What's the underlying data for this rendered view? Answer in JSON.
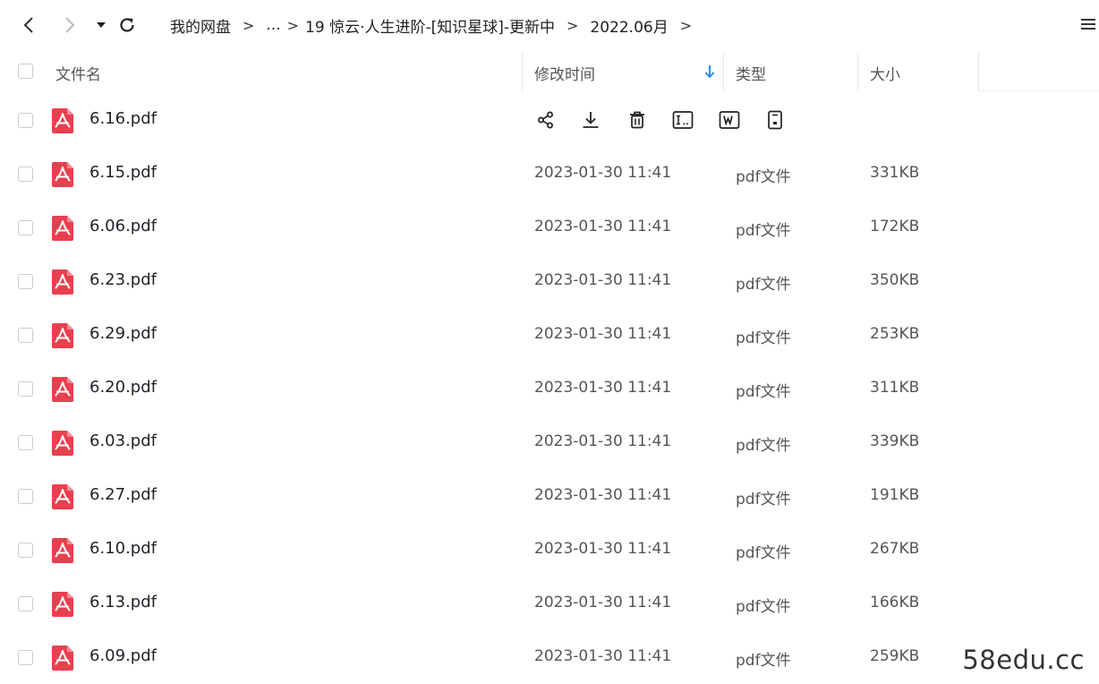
{
  "nav": {
    "back_icon": "chevron-left-icon",
    "forward_icon": "chevron-right-icon",
    "history_icon": "caret-down-icon",
    "refresh_icon": "refresh-icon"
  },
  "breadcrumb": {
    "items": [
      "我的网盘",
      "...",
      "19 惊云·人生进阶-[知识星球]-更新中",
      "2022.06月"
    ],
    "separator": ">"
  },
  "table": {
    "columns": {
      "name": "文件名",
      "modified": "修改时间",
      "type": "类型",
      "size": "大小"
    },
    "sort_icon": "arrow-down-icon",
    "rows": [
      {
        "name": "6.16.pdf",
        "modified": "",
        "type": "",
        "size": "",
        "hovered": true
      },
      {
        "name": "6.15.pdf",
        "modified": "2023-01-30 11:41",
        "type": "pdf文件",
        "size": "331KB"
      },
      {
        "name": "6.06.pdf",
        "modified": "2023-01-30 11:41",
        "type": "pdf文件",
        "size": "172KB"
      },
      {
        "name": "6.23.pdf",
        "modified": "2023-01-30 11:41",
        "type": "pdf文件",
        "size": "350KB"
      },
      {
        "name": "6.29.pdf",
        "modified": "2023-01-30 11:41",
        "type": "pdf文件",
        "size": "253KB"
      },
      {
        "name": "6.20.pdf",
        "modified": "2023-01-30 11:41",
        "type": "pdf文件",
        "size": "311KB"
      },
      {
        "name": "6.03.pdf",
        "modified": "2023-01-30 11:41",
        "type": "pdf文件",
        "size": "339KB"
      },
      {
        "name": "6.27.pdf",
        "modified": "2023-01-30 11:41",
        "type": "pdf文件",
        "size": "191KB"
      },
      {
        "name": "6.10.pdf",
        "modified": "2023-01-30 11:41",
        "type": "pdf文件",
        "size": "267KB"
      },
      {
        "name": "6.13.pdf",
        "modified": "2023-01-30 11:41",
        "type": "pdf文件",
        "size": "166KB"
      },
      {
        "name": "6.09.pdf",
        "modified": "2023-01-30 11:41",
        "type": "pdf文件",
        "size": "259KB"
      }
    ],
    "row_actions": [
      "share-icon",
      "download-icon",
      "delete-icon",
      "rename-icon",
      "word-doc-icon",
      "more-file-icon"
    ]
  },
  "colors": {
    "pdf_red": "#e8404f",
    "accent_blue": "#2b8ef3",
    "text": "#1f2329",
    "muted": "#555555"
  },
  "watermark": "58edu.cc"
}
